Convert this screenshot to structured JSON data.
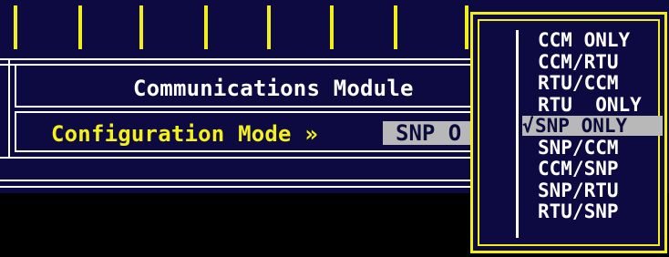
{
  "panel": {
    "title": "Communications Module",
    "field_label": "Configuration Mode »",
    "field_value": "SNP O"
  },
  "popup": {
    "selected_marker": "√",
    "options": [
      "CCM ONLY",
      "CCM/RTU",
      "RTU/CCM",
      "RTU  ONLY",
      "SNP ONLY",
      "SNP/CCM",
      "CCM/SNP",
      "SNP/RTU",
      "RTU/SNP"
    ],
    "selected_index": 4
  },
  "colors": {
    "background": "#0c0a40",
    "accent_yellow": "#f2ee1a",
    "text_white": "#ffffff",
    "highlight_gray": "#b8b8b8",
    "lower_band": "#000000"
  }
}
